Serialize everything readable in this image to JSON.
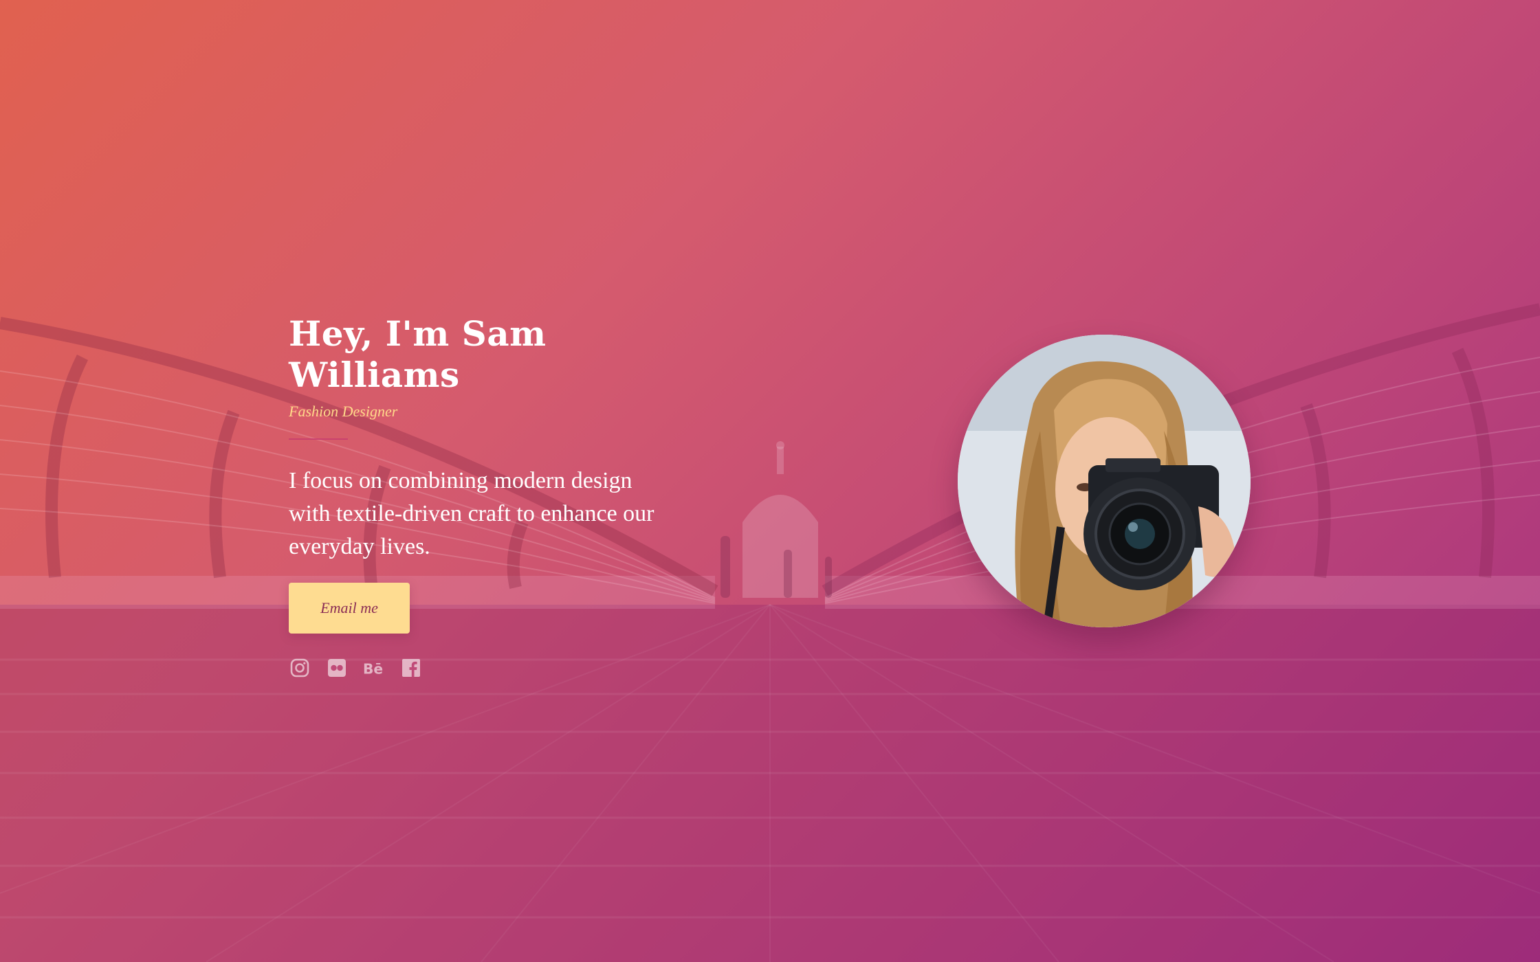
{
  "hero": {
    "title": "Hey, I'm Sam Williams",
    "subtitle": "Fashion Designer",
    "bio": "I focus on combining modern design with textile-driven craft to enhance our everyday lives.",
    "cta_label": "Email me"
  },
  "socials": [
    {
      "name": "instagram",
      "icon": "instagram-icon"
    },
    {
      "name": "flickr",
      "icon": "flickr-icon"
    },
    {
      "name": "behance",
      "icon": "behance-icon"
    },
    {
      "name": "facebook",
      "icon": "facebook-icon"
    }
  ],
  "colors": {
    "gradient_start": "#e2624e",
    "gradient_end": "#a02d82",
    "subtitle": "#ffd98a",
    "cta_background": "#fedc91",
    "cta_text": "#8a2d55",
    "icons": "rgba(255,255,255,0.6)"
  }
}
